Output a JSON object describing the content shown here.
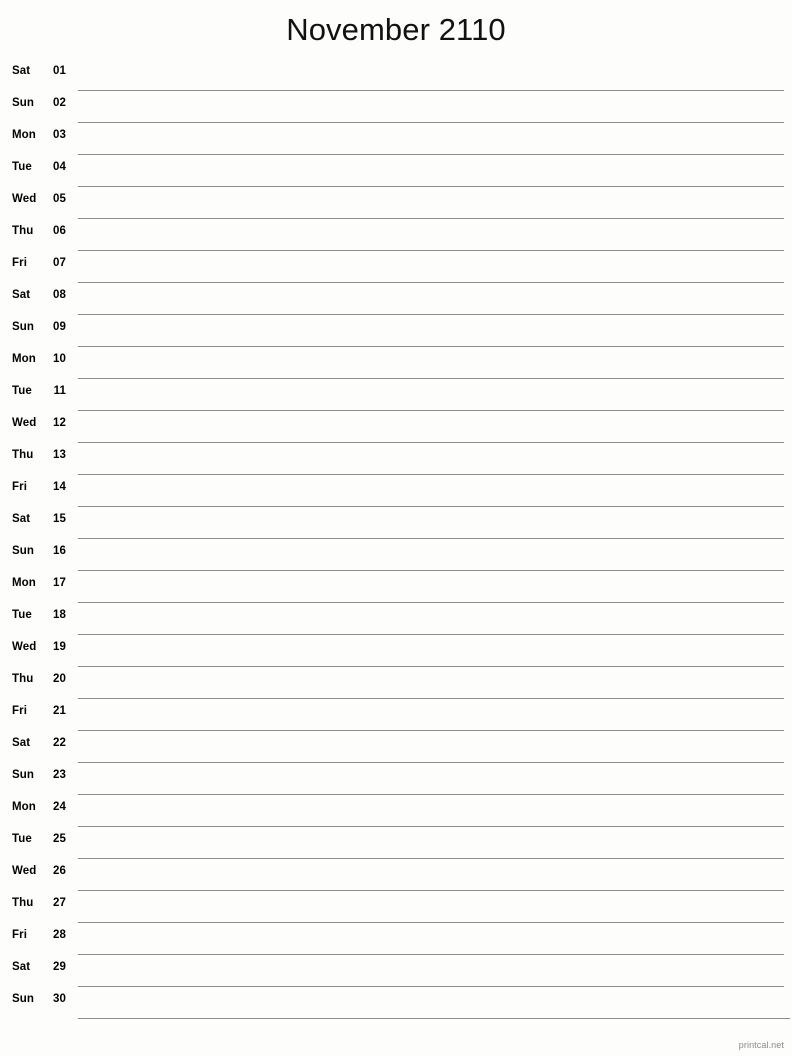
{
  "page": {
    "background_color": "#fdfdfb",
    "text_color": "#000000",
    "line_color": "#8d8d88",
    "footer_color": "#8a8a86"
  },
  "header": {
    "title": "November 2110",
    "month_name": "November",
    "year": "2110"
  },
  "calendar": {
    "type": "month-notes-list",
    "days_in_month": 30,
    "first_weekday": "Sat",
    "rows": [
      {
        "weekday": "Sat",
        "date": "01"
      },
      {
        "weekday": "Sun",
        "date": "02"
      },
      {
        "weekday": "Mon",
        "date": "03"
      },
      {
        "weekday": "Tue",
        "date": "04"
      },
      {
        "weekday": "Wed",
        "date": "05"
      },
      {
        "weekday": "Thu",
        "date": "06"
      },
      {
        "weekday": "Fri",
        "date": "07"
      },
      {
        "weekday": "Sat",
        "date": "08"
      },
      {
        "weekday": "Sun",
        "date": "09"
      },
      {
        "weekday": "Mon",
        "date": "10"
      },
      {
        "weekday": "Tue",
        "date": "11"
      },
      {
        "weekday": "Wed",
        "date": "12"
      },
      {
        "weekday": "Thu",
        "date": "13"
      },
      {
        "weekday": "Fri",
        "date": "14"
      },
      {
        "weekday": "Sat",
        "date": "15"
      },
      {
        "weekday": "Sun",
        "date": "16"
      },
      {
        "weekday": "Mon",
        "date": "17"
      },
      {
        "weekday": "Tue",
        "date": "18"
      },
      {
        "weekday": "Wed",
        "date": "19"
      },
      {
        "weekday": "Thu",
        "date": "20"
      },
      {
        "weekday": "Fri",
        "date": "21"
      },
      {
        "weekday": "Sat",
        "date": "22"
      },
      {
        "weekday": "Sun",
        "date": "23"
      },
      {
        "weekday": "Mon",
        "date": "24"
      },
      {
        "weekday": "Tue",
        "date": "25"
      },
      {
        "weekday": "Wed",
        "date": "26"
      },
      {
        "weekday": "Thu",
        "date": "27"
      },
      {
        "weekday": "Fri",
        "date": "28"
      },
      {
        "weekday": "Sat",
        "date": "29"
      },
      {
        "weekday": "Sun",
        "date": "30"
      }
    ]
  },
  "footer": {
    "label": "printcal.net"
  }
}
